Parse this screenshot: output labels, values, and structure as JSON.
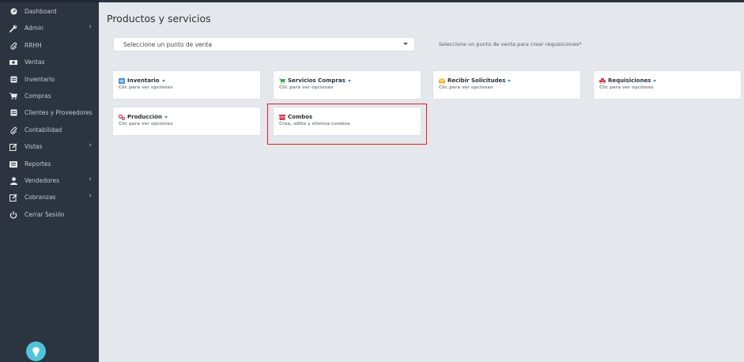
{
  "sidebar": {
    "items": [
      {
        "label": "Dashboard",
        "icon": "speedometer-icon",
        "chevron": false
      },
      {
        "label": "Admin",
        "icon": "wrench-icon",
        "chevron": true
      },
      {
        "label": "RRHH",
        "icon": "paperclip-icon",
        "chevron": false
      },
      {
        "label": "Ventas",
        "icon": "cash-icon",
        "chevron": false
      },
      {
        "label": "Inventario",
        "icon": "box-icon",
        "chevron": false
      },
      {
        "label": "Compras",
        "icon": "cart-icon",
        "chevron": false
      },
      {
        "label": "Clientes y Proveedores",
        "icon": "box-icon",
        "chevron": false
      },
      {
        "label": "Contabilidad",
        "icon": "paperclip-icon",
        "chevron": false
      },
      {
        "label": "Vistas",
        "icon": "edit-icon",
        "chevron": true
      },
      {
        "label": "Reportes",
        "icon": "list-icon",
        "chevron": false
      },
      {
        "label": "Vendedores",
        "icon": "user-icon",
        "chevron": true
      },
      {
        "label": "Cobranzas",
        "icon": "edit-icon",
        "chevron": true
      },
      {
        "label": "Cerrar Sesión",
        "icon": "power-icon",
        "chevron": false
      }
    ]
  },
  "main": {
    "title": "Productos y servicios",
    "select_value": "Seleccione un punto de venta",
    "hint": "Seleccione un punto de venta para crear requisiciones*",
    "cards": [
      {
        "title": "Inventario",
        "subtitle": "Clic para ver opciones",
        "icon": "inventory-icon",
        "icon_color": "#3b8fd6",
        "dropdown": true
      },
      {
        "title": "Servicios Compras",
        "subtitle": "Clic para ver opciones",
        "icon": "cart-icon",
        "icon_color": "#3aa655",
        "dropdown": true
      },
      {
        "title": "Recibir Solicitudes",
        "subtitle": "Clic para ver opciones",
        "icon": "envelope-icon",
        "icon_color": "#f2b632",
        "dropdown": true
      },
      {
        "title": "Requisiciones",
        "subtitle": "Clic para ver opciones",
        "icon": "printer-icon",
        "icon_color": "#d9364a",
        "dropdown": true
      },
      {
        "title": "Producción",
        "subtitle": "Clic para ver opciones",
        "icon": "gears-icon",
        "icon_color": "#d9364a",
        "dropdown": true
      },
      {
        "title": "Combos",
        "subtitle": "Crea, edita y elimina combos",
        "icon": "combo-icon",
        "icon_color": "#d9364a",
        "dropdown": false
      }
    ]
  },
  "colors": {
    "sidebar_bg": "#2b3440",
    "main_bg": "#e4e7eb",
    "highlight": "#e0201f",
    "accent": "#3b8fd6"
  }
}
